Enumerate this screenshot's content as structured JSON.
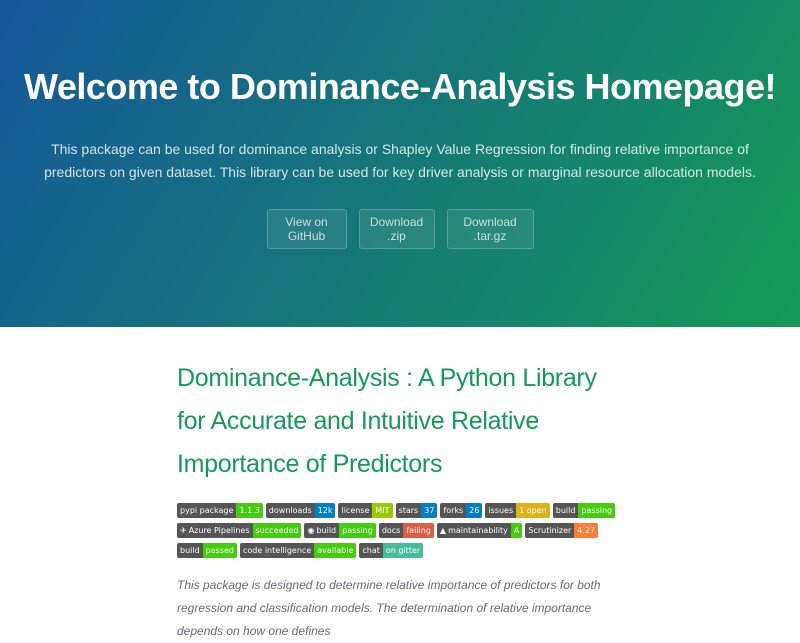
{
  "hero": {
    "title": "Welcome to Dominance-Analysis Homepage!",
    "tagline": "This package can be used for dominance analysis or Shapley Value Regression for finding relative importance of predictors on given dataset. This library can be used for key driver analysis or marginal resource allocation models.",
    "buttons": {
      "github": "View on GitHub",
      "zip": "Download .zip",
      "targz": "Download .tar.gz"
    },
    "gradient": [
      "#155799",
      "#159957"
    ]
  },
  "main": {
    "heading": "Dominance-Analysis : A Python Library for Accurate and Intuitive Relative Importance of Predictors",
    "heading_color": "#159957",
    "badges": [
      {
        "label": "pypi package",
        "value": "1.1.3",
        "color": "#4c1"
      },
      {
        "label": "downloads",
        "value": "12k",
        "color": "#007ec6"
      },
      {
        "label": "license",
        "value": "MIT",
        "color": "#97ca00"
      },
      {
        "label": "stars",
        "value": "37",
        "color": "#007ec6"
      },
      {
        "label": "forks",
        "value": "26",
        "color": "#007ec6"
      },
      {
        "label": "issues",
        "value": "1 open",
        "color": "#dfb317"
      },
      {
        "label": "build",
        "value": "passing",
        "color": "#4c1"
      },
      {
        "label": "Azure Pipelines",
        "value": "succeeded",
        "color": "#4c1",
        "icon": "rocket-icon"
      },
      {
        "label": "build",
        "value": "passing",
        "color": "#4c1",
        "icon": "circleci-icon"
      },
      {
        "label": "docs",
        "value": "failing",
        "color": "#e05d44"
      },
      {
        "label": "maintainability",
        "value": "A",
        "color": "#4c1",
        "icon": "codeclimate-icon"
      },
      {
        "label": "Scrutinizer",
        "value": "4.27",
        "color": "#fe7d37"
      },
      {
        "label": "build",
        "value": "passed",
        "color": "#4c1"
      },
      {
        "label": "code intelligence",
        "value": "available",
        "color": "#4c1"
      },
      {
        "label": "chat",
        "value": "on gitter",
        "color": "#46bc99"
      }
    ],
    "description": "This package is designed to determine relative importance of predictors for both regression and classification models. The determination of relative importance depends on how one defines"
  }
}
